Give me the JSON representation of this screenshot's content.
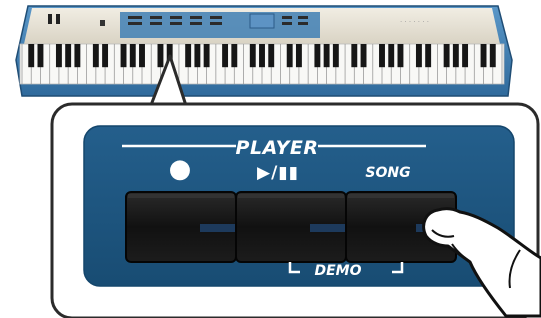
{
  "panel": {
    "title": "PLAYER",
    "rec_symbol": "●",
    "play_pause_symbol": "▶/▮▮",
    "song_label": "SONG",
    "demo_label": "DEMO"
  },
  "colors": {
    "panel_blue": "#1f5a85",
    "button_dark": "#141414",
    "button_led": "#1d3a5c",
    "piano_body": "#3f7fb4",
    "piano_top": "#e9e5da",
    "callout_border": "#2b2b2b"
  },
  "icons": {
    "hand": "pointing-hand-icon",
    "record": "record-dot-icon",
    "play_pause": "play-pause-icon"
  }
}
